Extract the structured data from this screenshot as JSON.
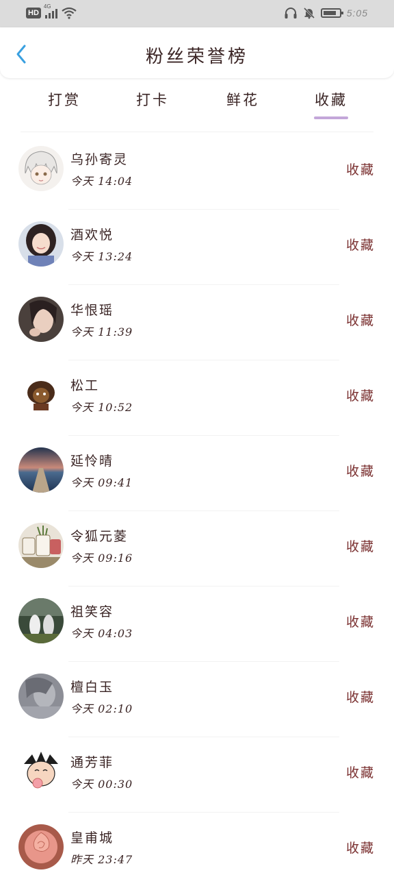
{
  "status_bar": {
    "network_badge": "HD",
    "network_type": "4G",
    "time": "5:05"
  },
  "header": {
    "title": "粉丝荣誉榜",
    "back_icon": "chevron-left-icon"
  },
  "tabs": [
    {
      "label": "打赏",
      "active": false
    },
    {
      "label": "打卡",
      "active": false
    },
    {
      "label": "鲜花",
      "active": false
    },
    {
      "label": "收藏",
      "active": true
    }
  ],
  "colors": {
    "accent_underline": "#c3a6d9",
    "back_arrow": "#3aa0e0",
    "action_text": "#7a3030"
  },
  "fans": [
    {
      "name": "乌孙寄灵",
      "time": "今天 14:04",
      "action": "收藏",
      "avatar": "anime-girl-avatar"
    },
    {
      "name": "酒欢悦",
      "time": "今天 13:24",
      "action": "收藏",
      "avatar": "girl-photo-avatar"
    },
    {
      "name": "华恨瑶",
      "time": "今天 11:39",
      "action": "收藏",
      "avatar": "girl-photo-avatar"
    },
    {
      "name": "松工",
      "time": "今天 10:52",
      "action": "收藏",
      "avatar": "cartoon-figure-avatar"
    },
    {
      "name": "延怜晴",
      "time": "今天 09:41",
      "action": "收藏",
      "avatar": "pier-sunset-avatar"
    },
    {
      "name": "令狐元菱",
      "time": "今天 09:16",
      "action": "收藏",
      "avatar": "mugs-photo-avatar"
    },
    {
      "name": "祖笑容",
      "time": "今天 04:03",
      "action": "收藏",
      "avatar": "field-photo-avatar"
    },
    {
      "name": "檀白玉",
      "time": "今天 02:10",
      "action": "收藏",
      "avatar": "gray-photo-avatar"
    },
    {
      "name": "通芳菲",
      "time": "今天 00:30",
      "action": "收藏",
      "avatar": "cartoon-baby-avatar"
    },
    {
      "name": "皇甫城",
      "time": "昨天 23:47",
      "action": "收藏",
      "avatar": "rose-photo-avatar"
    }
  ]
}
